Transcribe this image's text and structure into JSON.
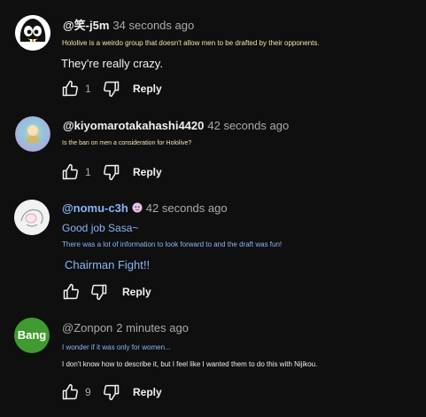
{
  "comments": [
    {
      "handle": "@笑-j5m",
      "time": "34 seconds ago",
      "lines": [
        "Hololive is a weirdo group that doesn't allow men to be drafted by their opponents.",
        "They're really crazy."
      ],
      "likes": "1",
      "reply": "Reply",
      "avatar": "penguin-avatar"
    },
    {
      "handle": "@kiyomarotakahashi4420",
      "time": "42 seconds ago",
      "lines": [
        "Is the ban on men a consideration for Hololive?"
      ],
      "likes": "1",
      "reply": "Reply",
      "avatar": "colorful-avatar"
    },
    {
      "handle": "@nomu-c3h",
      "time": "42 seconds ago",
      "lines": [
        "Good job Sasa~",
        "There was a lot of information to look forward to and the draft was fun!",
        "Chairman Fight!!"
      ],
      "likes": "",
      "reply": "Reply",
      "avatar": "sketch-avatar"
    },
    {
      "handle": "@Zonpon",
      "time": "2 minutes ago",
      "lines": [
        "I wonder if it was only for women...",
        "I don't know how to describe it, but I feel like I wanted them to do this with Nijikou."
      ],
      "likes": "9",
      "reply": "Reply",
      "avatar": "bang-avatar",
      "avatar_text": "Bang"
    }
  ],
  "colors": {
    "background": "#0f0f0f",
    "text": "#f1f1f1",
    "muted": "#aaaaaa",
    "line1_c1": "#f3e5a8",
    "blue_text": "#8ab4f8",
    "bang_bg": "#3f9b2f"
  }
}
